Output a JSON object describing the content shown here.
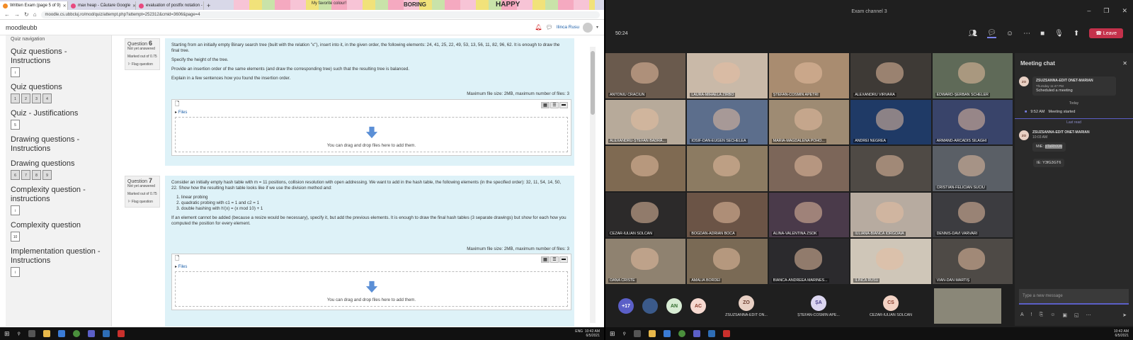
{
  "browser": {
    "tabs": [
      {
        "label": "Written Exam (page 5 of 9)",
        "color": "#f28b26"
      },
      {
        "label": "max heap - Căutare Google",
        "color": "#e84a7f"
      },
      {
        "label": "evaluation of postfix notation -",
        "color": "#e84a7f"
      }
    ],
    "theme_words": [
      "BORING",
      "HAPPY",
      "My favorite colour!"
    ],
    "url": "moodle.cs.ubbcluj.ro/mod/quiz/attempt.php?attempt=252312&cmid=3606&page=4"
  },
  "moodle": {
    "brand": "moodleubb",
    "user": "Ilinca Rusu",
    "nav_title": "Quiz navigation",
    "sections": [
      {
        "title": "Quiz questions - Instructions",
        "boxes": [
          "i"
        ]
      },
      {
        "title": "Quiz questions",
        "boxes": [
          "1",
          "2",
          "3",
          "4"
        ]
      },
      {
        "title": "Quiz - Justifications",
        "boxes": [
          "5"
        ]
      },
      {
        "title": "Drawing questions - Instructions",
        "boxes": []
      },
      {
        "title": "Drawing questions",
        "boxes": [
          "6",
          "7",
          "8",
          "9"
        ]
      },
      {
        "title": "Complexity question - instructions",
        "boxes": [
          "i"
        ]
      },
      {
        "title": "Complexity question",
        "boxes": [
          "10"
        ]
      },
      {
        "title": "Implementation question - Instructions",
        "boxes": [
          "i"
        ]
      }
    ],
    "questions": [
      {
        "label": "Question",
        "number": "6",
        "status": "Not yet answered",
        "marked": "Marked out of 0.75",
        "flag": "Flag question",
        "text": [
          "Starting from an initially empty Binary search tree (built with the relation \"≤\"), insert into it, in the given order, the following elements: 24, 41, 25, 22, 49, 53, 13, 56, 11, 82, 96, 62. It is enough to draw the final tree.",
          "Specify the height of the tree.",
          "Provide an insertion order of the same elements (and draw the corresponding tree) such that the resulting tree is balanced.",
          "Explain in a few sentences how you found the insertion order."
        ],
        "list": [],
        "after": "",
        "max_size": "Maximum file size: 2MB, maximum number of files: 3",
        "files_label": "Files",
        "drop_hint": "You can drag and drop files here to add them."
      },
      {
        "label": "Question",
        "number": "7",
        "status": "Not yet answered",
        "marked": "Marked out of 0.75",
        "flag": "Flag question",
        "text": [
          "Consider an initially empty hash table with m = 11 positions, collision resolution with open addressing. We want to add in the hash table, the following elements (in the specified order): 32, 11, 54, 14, 50, 22. Show how the resulting hash table looks like if we use the division method and:"
        ],
        "list": [
          "linear probing",
          "quadratic probing with c1 = 1 and c2 = 1",
          "double hashing with h'(x) = (x mod 10) + 1"
        ],
        "after": "If an element cannot be added (because a resize would be necessary), specify it, but add the previous elements. It is enough to draw the final hash tables (3 separate drawings) but show for each how you computed the position for every element.",
        "max_size": "Maximum file size: 2MB, maximum number of files: 3",
        "files_label": "Files",
        "drop_hint": "You can drag and drop files here to add them."
      }
    ],
    "clock": "10:42 AM",
    "date": "6/5/2021",
    "lang": "ENG"
  },
  "teams": {
    "window_title": "Exam channel 3",
    "timer": "50:24",
    "leave_label": "Leave",
    "participants": [
      {
        "name": "ANTONIU CRACIUN",
        "bg": "#6a5a4d"
      },
      {
        "name": "LAURA-MIHAELA ZIRBO",
        "bg": "#c9b9a8"
      },
      {
        "name": "ȘTEFAN-COSMIN APETRI",
        "bg": "#a98c70"
      },
      {
        "name": "ALEXANDRU VIRVARA",
        "bg": "#3e3a36"
      },
      {
        "name": "EDWARD-ȘERBAN SCHELER",
        "bg": "#5f6a58"
      },
      {
        "name": "ALEXANDRU-ȘTEFAN BADRĂ...",
        "bg": "#b7aa9a"
      },
      {
        "name": "IOSIF-DAN-EUGEN SECHELEA",
        "bg": "#5c6e8c"
      },
      {
        "name": "MARIA-MAGDALENA POHO...",
        "bg": "#9e8b73"
      },
      {
        "name": "ANDREI NEGREA",
        "bg": "#1f3a66"
      },
      {
        "name": "ARMAND-ARCADIS SILAGHI",
        "bg": "#39446a"
      },
      {
        "name": "",
        "bg": "#7f6a52"
      },
      {
        "name": "",
        "bg": "#8c7b62"
      },
      {
        "name": "",
        "bg": "#7c6659"
      },
      {
        "name": "",
        "bg": "#4f4a45"
      },
      {
        "name": "CRISTIAN-FELICIAN SUCIU",
        "bg": "#5a5f66"
      },
      {
        "name": "CEZAR-IULIAN SOLCAN",
        "bg": "#2c2a2a"
      },
      {
        "name": "BOGDAN-ADRIAN BOCA",
        "bg": "#6b5446"
      },
      {
        "name": "ALINA-VALENTINA ZSOK",
        "bg": "#4a3a4a"
      },
      {
        "name": "IULIANA-BIANCA IORGOAIA",
        "bg": "#b7aba0"
      },
      {
        "name": "DENNIS-DAVI VARVARI",
        "bg": "#3c3c40"
      },
      {
        "name": "OANA CRISTE",
        "bg": "#8f8270"
      },
      {
        "name": "AMALIA BORDEI",
        "bg": "#7a6a55"
      },
      {
        "name": "BIANCA-ANDREEA MARINES...",
        "bg": "#2b2a2d"
      },
      {
        "name": "ILINCA RUSU",
        "bg": "#cfc6b8"
      },
      {
        "name": "VIAN-DAN MARTIȘ",
        "bg": "#4e4a46"
      }
    ],
    "more_count": "+17",
    "bottom_circles": [
      {
        "text": "AN",
        "bg": "#d8ecd4",
        "fg": "#2f6a2a"
      },
      {
        "text": "AC",
        "bg": "#f6d9d0",
        "fg": "#8a3b2a"
      }
    ],
    "bottom_cards": [
      {
        "initials": "ZO",
        "name": "ZSUZSANNA-EDIT ON...",
        "bg": "#e8d0c4",
        "fg": "#6b3d2e"
      },
      {
        "initials": "ȘA",
        "name": "ȘTEFAN-COSMIN APE...",
        "bg": "#dcd6f0",
        "fg": "#4a3f8a"
      },
      {
        "initials": "CS",
        "name": "CEZAR-IULIAN SOLCAN",
        "bg": "#f3d3c5",
        "fg": "#8a3b2a"
      }
    ],
    "chat": {
      "title": "Meeting chat",
      "author": "ZSUZSANNA-EDIT ONET-MARIAN",
      "initials": "ZO",
      "msg1_time": "Thursday 11:47 PM",
      "msg1_text": "Scheduled a meeting",
      "today": "Today",
      "event_time": "9:52 AM",
      "event_text": "Meeting started",
      "last_read": "Last read",
      "msg2_time": "10:03 AM",
      "msg2_prefix": "MiE:",
      "msg2_hidden": "pTaRhXAt",
      "msg3_text": "IE: Y3fG3GT6",
      "compose_placeholder": "Type a new message"
    },
    "clock": "10:42 AM",
    "date": "6/5/2021"
  }
}
